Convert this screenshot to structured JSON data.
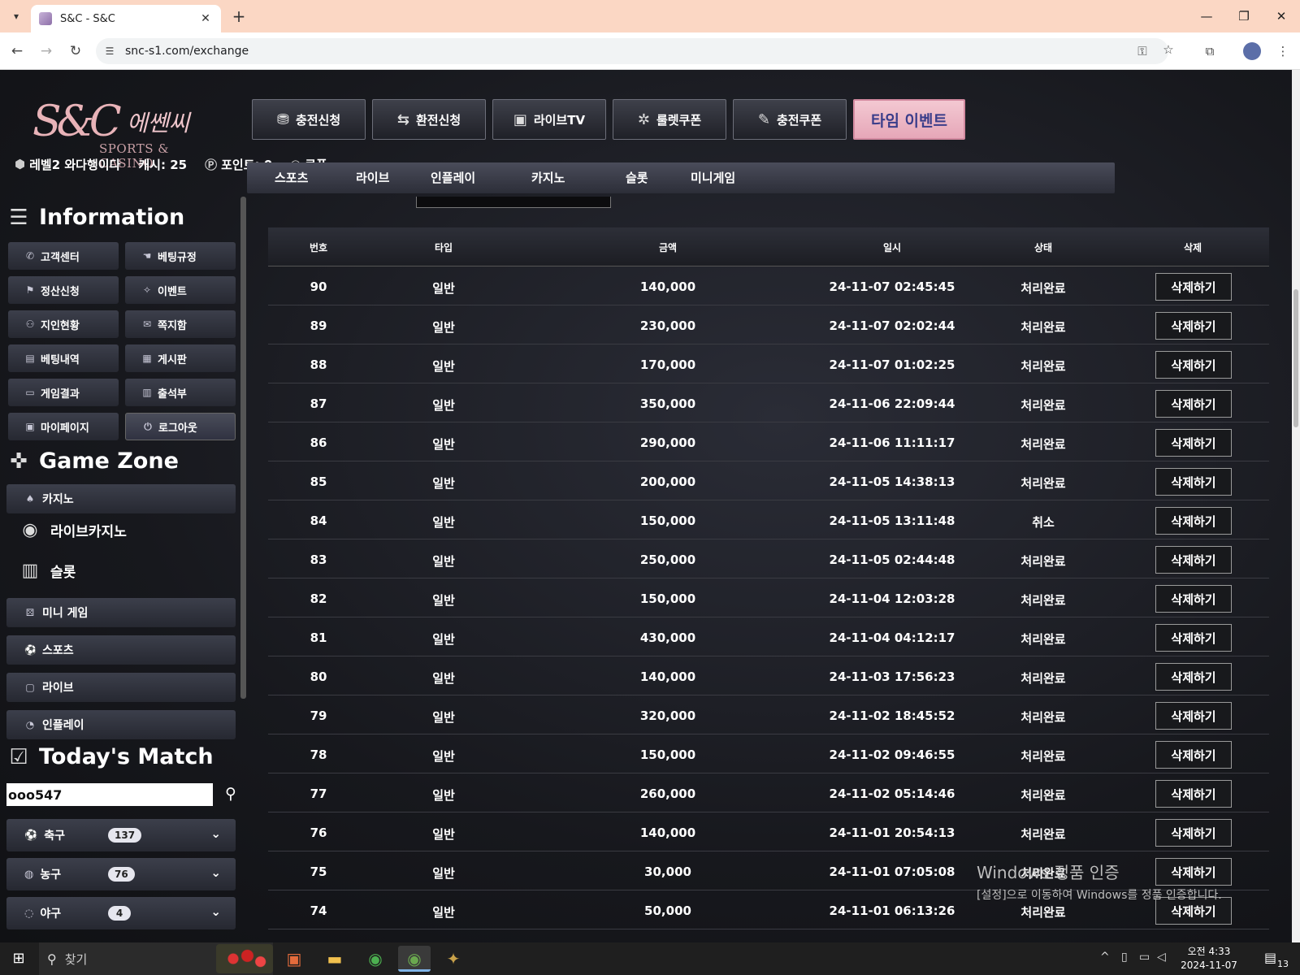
{
  "browser": {
    "tab_title": "S&C - S&C",
    "url": "snc-s1.com/exchange",
    "new_tab": "+",
    "close_tab": "✕"
  },
  "header": {
    "logo_mark": "S&C",
    "logo_korean": "에쎈씨",
    "logo_english": "SPORTS & CASINO",
    "top_buttons": [
      {
        "label": "충전신청",
        "icon": "coins-icon"
      },
      {
        "label": "환전신청",
        "icon": "exchange-icon"
      },
      {
        "label": "라이브TV",
        "icon": "live-tv-icon"
      },
      {
        "label": "룰렛쿠폰",
        "icon": "roulette-icon"
      },
      {
        "label": "충전쿠폰",
        "icon": "ticket-icon"
      },
      {
        "label": "타임 이벤트",
        "icon": ""
      }
    ],
    "user": {
      "level": "레벨2 와다행이다",
      "cash": "캐시: 25",
      "points": "포인트: 0",
      "coupon": "쿠폰"
    },
    "gnb": [
      "스포츠",
      "라이브",
      "인플레이",
      "카지노",
      "슬롯",
      "미니게임"
    ]
  },
  "sidebar": {
    "information_title": "Information",
    "info_buttons": [
      {
        "label": "고객센터",
        "icon": "phone-icon"
      },
      {
        "label": "베팅규정",
        "icon": "hand-icon"
      },
      {
        "label": "정산신청",
        "icon": "settle-icon"
      },
      {
        "label": "이벤트",
        "icon": "party-icon"
      },
      {
        "label": "지인현황",
        "icon": "people-icon"
      },
      {
        "label": "쪽지함",
        "icon": "message-icon"
      },
      {
        "label": "베팅내역",
        "icon": "history-icon"
      },
      {
        "label": "게시판",
        "icon": "board-icon"
      },
      {
        "label": "게임결과",
        "icon": "result-icon"
      },
      {
        "label": "출석부",
        "icon": "calendar-icon"
      },
      {
        "label": "마이페이지",
        "icon": "user-card-icon"
      },
      {
        "label": "로그아웃",
        "icon": "power-icon"
      }
    ],
    "game_zone_title": "Game Zone",
    "game_zone": {
      "casino": "카지노",
      "live_casino": "라이브카지노",
      "slot": "슬롯",
      "mini_game": "미니 게임",
      "sports": "스포츠",
      "live": "라이브",
      "inplay": "인플레이"
    },
    "todays_match_title": "Today's Match",
    "search_value": "ooo547",
    "sports": [
      {
        "label": "축구",
        "count": "137"
      },
      {
        "label": "농구",
        "count": "76"
      },
      {
        "label": "야구",
        "count": "4"
      }
    ]
  },
  "table": {
    "headers": [
      "번호",
      "타입",
      "금액",
      "일시",
      "상태",
      "삭제"
    ],
    "delete_label": "삭제하기",
    "rows": [
      {
        "no": "90",
        "type": "일반",
        "amount": "140,000",
        "datetime": "24-11-07 02:45:45",
        "status": "처리완료"
      },
      {
        "no": "89",
        "type": "일반",
        "amount": "230,000",
        "datetime": "24-11-07 02:02:44",
        "status": "처리완료"
      },
      {
        "no": "88",
        "type": "일반",
        "amount": "170,000",
        "datetime": "24-11-07 01:02:25",
        "status": "처리완료"
      },
      {
        "no": "87",
        "type": "일반",
        "amount": "350,000",
        "datetime": "24-11-06 22:09:44",
        "status": "처리완료"
      },
      {
        "no": "86",
        "type": "일반",
        "amount": "290,000",
        "datetime": "24-11-06 11:11:17",
        "status": "처리완료"
      },
      {
        "no": "85",
        "type": "일반",
        "amount": "200,000",
        "datetime": "24-11-05 14:38:13",
        "status": "처리완료"
      },
      {
        "no": "84",
        "type": "일반",
        "amount": "150,000",
        "datetime": "24-11-05 13:11:48",
        "status": "취소"
      },
      {
        "no": "83",
        "type": "일반",
        "amount": "250,000",
        "datetime": "24-11-05 02:44:48",
        "status": "처리완료"
      },
      {
        "no": "82",
        "type": "일반",
        "amount": "150,000",
        "datetime": "24-11-04 12:03:28",
        "status": "처리완료"
      },
      {
        "no": "81",
        "type": "일반",
        "amount": "430,000",
        "datetime": "24-11-04 04:12:17",
        "status": "처리완료"
      },
      {
        "no": "80",
        "type": "일반",
        "amount": "140,000",
        "datetime": "24-11-03 17:56:23",
        "status": "처리완료"
      },
      {
        "no": "79",
        "type": "일반",
        "amount": "320,000",
        "datetime": "24-11-02 18:45:52",
        "status": "처리완료"
      },
      {
        "no": "78",
        "type": "일반",
        "amount": "150,000",
        "datetime": "24-11-02 09:46:55",
        "status": "처리완료"
      },
      {
        "no": "77",
        "type": "일반",
        "amount": "260,000",
        "datetime": "24-11-02 05:14:46",
        "status": "처리완료"
      },
      {
        "no": "76",
        "type": "일반",
        "amount": "140,000",
        "datetime": "24-11-01 20:54:13",
        "status": "처리완료"
      },
      {
        "no": "75",
        "type": "일반",
        "amount": "30,000",
        "datetime": "24-11-01 07:05:08",
        "status": "처리완료"
      },
      {
        "no": "74",
        "type": "일반",
        "amount": "50,000",
        "datetime": "24-11-01 06:13:26",
        "status": "처리완료"
      }
    ]
  },
  "watermark": {
    "line1": "Windows 정품 인증",
    "line2": "[설정]으로 이동하여 Windows를 정품 인증합니다."
  },
  "taskbar": {
    "search_label": "찾기",
    "time": "오전 4:33",
    "date": "2024-11-07",
    "notifications": "13"
  }
}
